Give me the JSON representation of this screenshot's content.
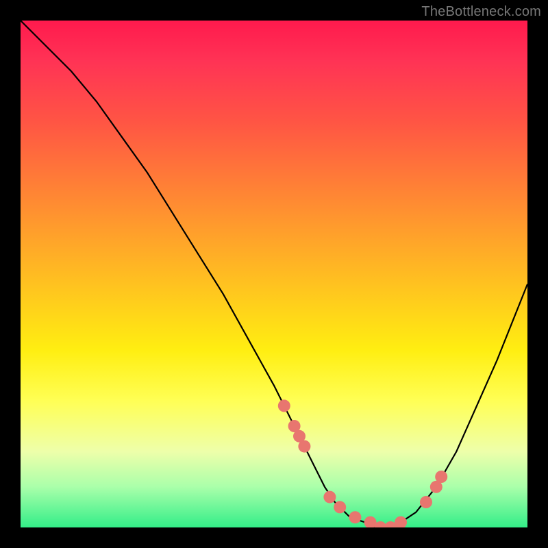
{
  "attribution": "TheBottleneck.com",
  "chart_data": {
    "type": "line",
    "title": "",
    "xlabel": "",
    "ylabel": "",
    "ylim": [
      0,
      100
    ],
    "xlim": [
      0,
      100
    ],
    "series": [
      {
        "name": "curve",
        "x": [
          0,
          5,
          10,
          15,
          20,
          25,
          30,
          35,
          40,
          45,
          50,
          55,
          58,
          60,
          62,
          65,
          68,
          70,
          73,
          75,
          78,
          82,
          86,
          90,
          94,
          100
        ],
        "values": [
          100,
          95,
          90,
          84,
          77,
          70,
          62,
          54,
          46,
          37,
          28,
          18,
          12,
          8,
          5,
          2,
          1,
          0,
          0,
          1,
          3,
          8,
          15,
          24,
          33,
          48
        ]
      }
    ],
    "markers": {
      "name": "points",
      "color": "#e8766f",
      "x": [
        52,
        54,
        55,
        56,
        61,
        63,
        66,
        69,
        71,
        73,
        75,
        80,
        82,
        83
      ],
      "values": [
        24,
        20,
        18,
        16,
        6,
        4,
        2,
        1,
        0,
        0,
        1,
        5,
        8,
        10
      ]
    }
  }
}
